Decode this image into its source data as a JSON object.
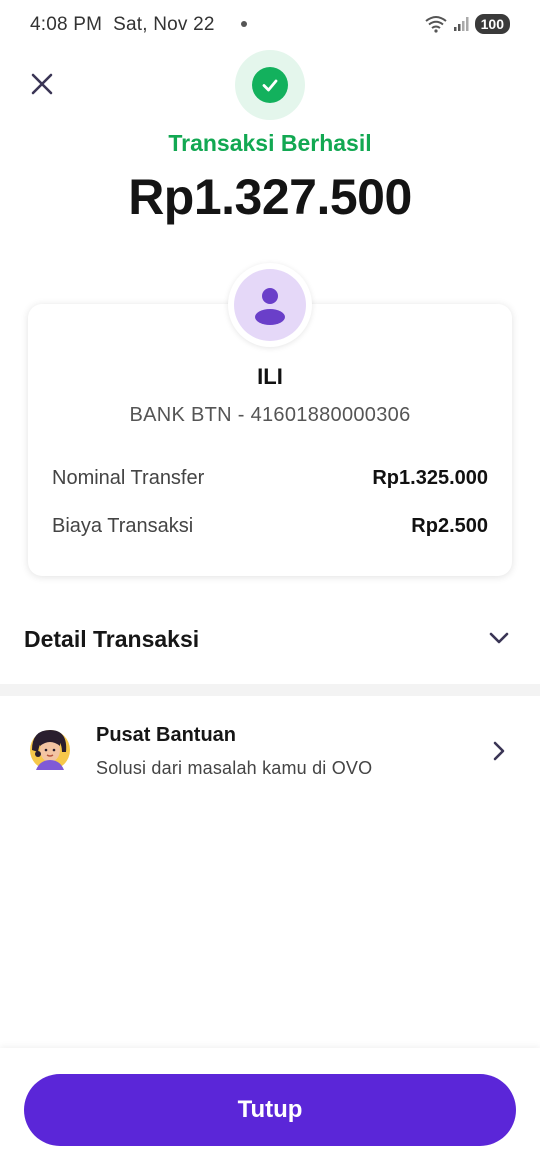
{
  "status_bar": {
    "time": "4:08 PM",
    "date": "Sat, Nov 22",
    "battery": "100"
  },
  "header": {
    "close_icon": "close-icon",
    "status_icon": "check-circle-icon",
    "status_title": "Transaksi Berhasil",
    "amount": "Rp1.327.500"
  },
  "recipient": {
    "avatar_icon": "person-icon",
    "name": "ILI",
    "bank_account": "BANK BTN - 41601880000306"
  },
  "breakdown": [
    {
      "label": "Nominal Transfer",
      "value": "Rp1.325.000"
    },
    {
      "label": "Biaya Transaksi",
      "value": "Rp2.500"
    }
  ],
  "detail_section": {
    "title": "Detail Transaksi",
    "chevron": "chevron-down-icon"
  },
  "help": {
    "title": "Pusat Bantuan",
    "subtitle": "Solusi dari masalah kamu di OVO",
    "chevron": "chevron-right-icon"
  },
  "footer": {
    "button_label": "Tutup"
  },
  "colors": {
    "success": "#12a852",
    "primary": "#5b26d8",
    "avatar_bg": "#e5d8f8",
    "avatar_fg": "#6a3fc9"
  }
}
